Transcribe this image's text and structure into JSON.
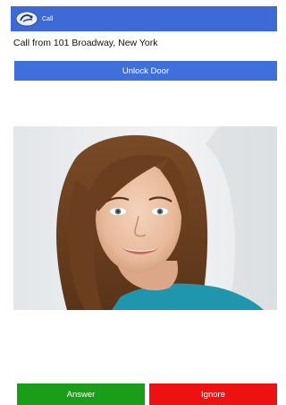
{
  "app": {
    "title": "Call",
    "logo_icon": "phone-call-logo-icon"
  },
  "call": {
    "caller_text": "Call from 101 Broadway, New York"
  },
  "actions": {
    "unlock_label": "Unlock Door",
    "answer_label": "Answer",
    "ignore_label": "Ignore"
  },
  "video": {
    "content": "caller-video-feed"
  },
  "colors": {
    "appbar": "#3d6ad6",
    "unlock": "#3f6fd9",
    "answer": "#1a9e1a",
    "ignore": "#ee1111"
  }
}
